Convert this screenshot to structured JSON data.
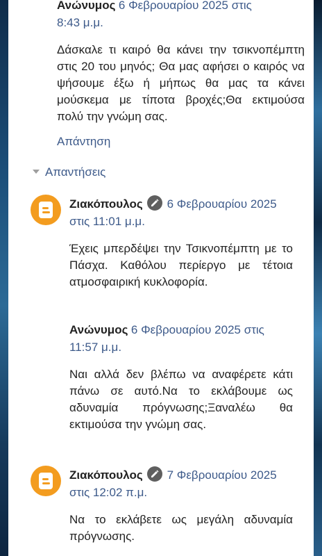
{
  "comments": [
    {
      "author": "Ανώνυμος",
      "date_line1": "6 Φεβρουαρίου 2025 στις",
      "date_line2": "8:43 μ.μ.",
      "body": "Δάσκαλε τι καιρό θα κάνει την τσικνοπέμπτη στις 20 του μηνός; Θα μας αφήσει ο καιρός να ψήσουμε έξω ή μήπως θα μας τα κάνει μούσκεμα με τίποτα βροχές;Θα εκτιμούσα πολύ την γνώμη σας.",
      "reply_label": "Απάντηση"
    }
  ],
  "replies_toggle_label": "Απαντήσεις",
  "replies": [
    {
      "author": "Ζιακόπουλος",
      "date_line1": "6 Φεβρουαρίου 2025",
      "date_line2": "στις 11:01 μ.μ.",
      "body": "Έχεις μπερδέψει την Τσικνοπέμπτη με το Πάσχα. Καθόλου περίεργο με τέτοια ατμοσφαιρική κυκλοφορία.",
      "avatar_icon": "blogger-icon",
      "badge_icon": "pencil-icon"
    },
    {
      "author": "Ανώνυμος",
      "date_line1": "6 Φεβρουαρίου 2025 στις",
      "date_line2": "11:57 μ.μ.",
      "body": "Ναι αλλά δεν βλέπω να αναφέρετε κάτι πάνω σε αυτό.Να το εκλάβουμε ως αδυναμία πρόγνωσης;Ξαναλέω θα εκτιμούσα την γνώμη σας."
    },
    {
      "author": "Ζιακόπουλος",
      "date_line1": "7 Φεβρουαρίου 2025",
      "date_line2": "στις 12:02 π.μ.",
      "body": "Να το εκλάβετε ως μεγάλη αδυναμία πρόγνωσης.",
      "avatar_icon": "blogger-icon",
      "badge_icon": "pencil-icon"
    }
  ],
  "colors": {
    "link": "#3d5a8a",
    "avatar": "#f39c1f",
    "text": "#222222"
  }
}
